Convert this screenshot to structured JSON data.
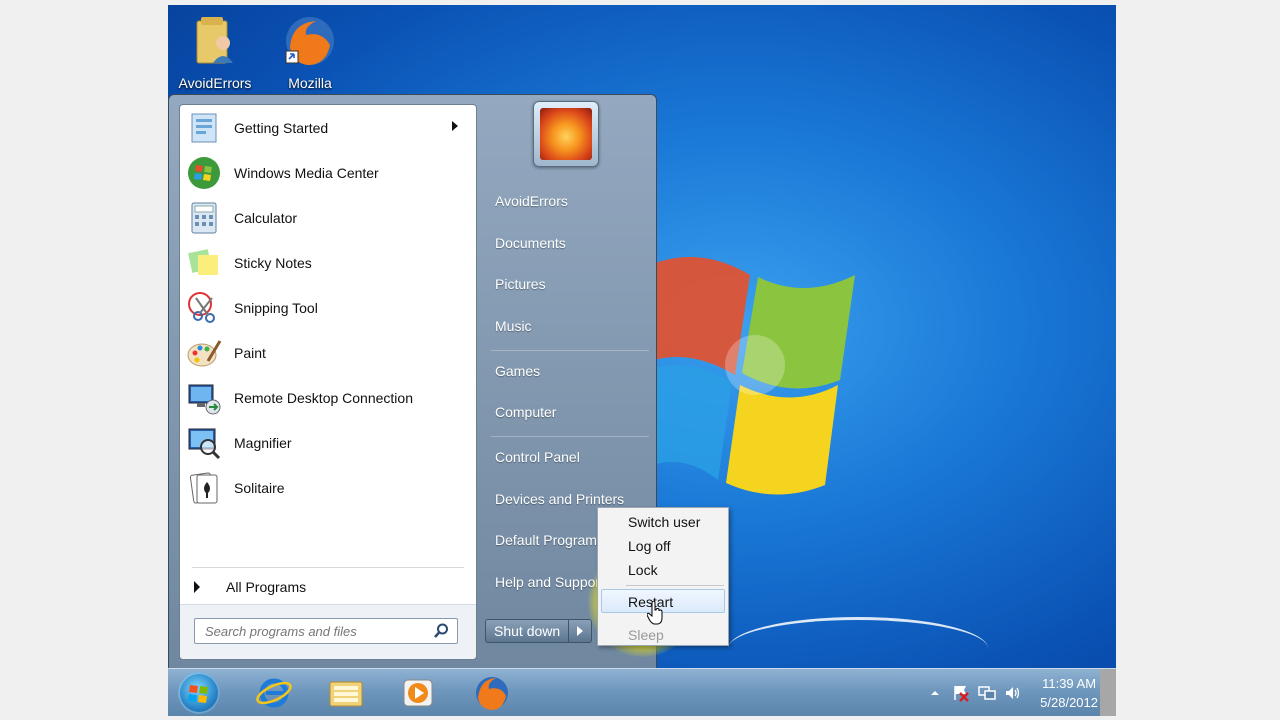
{
  "desktop": {
    "icons": [
      {
        "label": "AvoidErrors",
        "icon": "user-folder-icon"
      },
      {
        "label": "Mozilla Firefox",
        "icon": "firefox-icon"
      }
    ]
  },
  "start_menu": {
    "programs": [
      {
        "label": "Getting Started",
        "icon": "getting-started-icon",
        "has_submenu": true
      },
      {
        "label": "Windows Media Center",
        "icon": "media-center-icon"
      },
      {
        "label": "Calculator",
        "icon": "calculator-icon"
      },
      {
        "label": "Sticky Notes",
        "icon": "sticky-notes-icon"
      },
      {
        "label": "Snipping Tool",
        "icon": "snipping-tool-icon"
      },
      {
        "label": "Paint",
        "icon": "paint-icon"
      },
      {
        "label": "Remote Desktop Connection",
        "icon": "remote-desktop-icon"
      },
      {
        "label": "Magnifier",
        "icon": "magnifier-icon"
      },
      {
        "label": "Solitaire",
        "icon": "solitaire-icon"
      }
    ],
    "all_programs": "All Programs",
    "search_placeholder": "Search programs and files",
    "right_links": [
      "AvoidErrors",
      "Documents",
      "Pictures",
      "Music",
      "Games",
      "Computer",
      "Control Panel",
      "Devices and Printers",
      "Default Programs",
      "Help and Support"
    ],
    "shutdown_label": "Shut down"
  },
  "shutdown_menu": {
    "items": [
      "Switch user",
      "Log off",
      "Lock",
      "Restart",
      "Sleep"
    ],
    "hovered": "Restart",
    "disabled": "Sleep"
  },
  "taskbar": {
    "pinned": [
      "internet-explorer-icon",
      "explorer-folder-icon",
      "media-player-icon",
      "firefox-icon"
    ],
    "time": "11:39 AM",
    "date": "5/28/2012",
    "tray_icons": [
      "show-hidden-icons-icon",
      "action-center-icon",
      "network-icon",
      "volume-icon"
    ]
  },
  "colors": {
    "wallpaper": "#1a78d6",
    "highlight": "#fff000",
    "taskbar": "#6f97bd"
  }
}
